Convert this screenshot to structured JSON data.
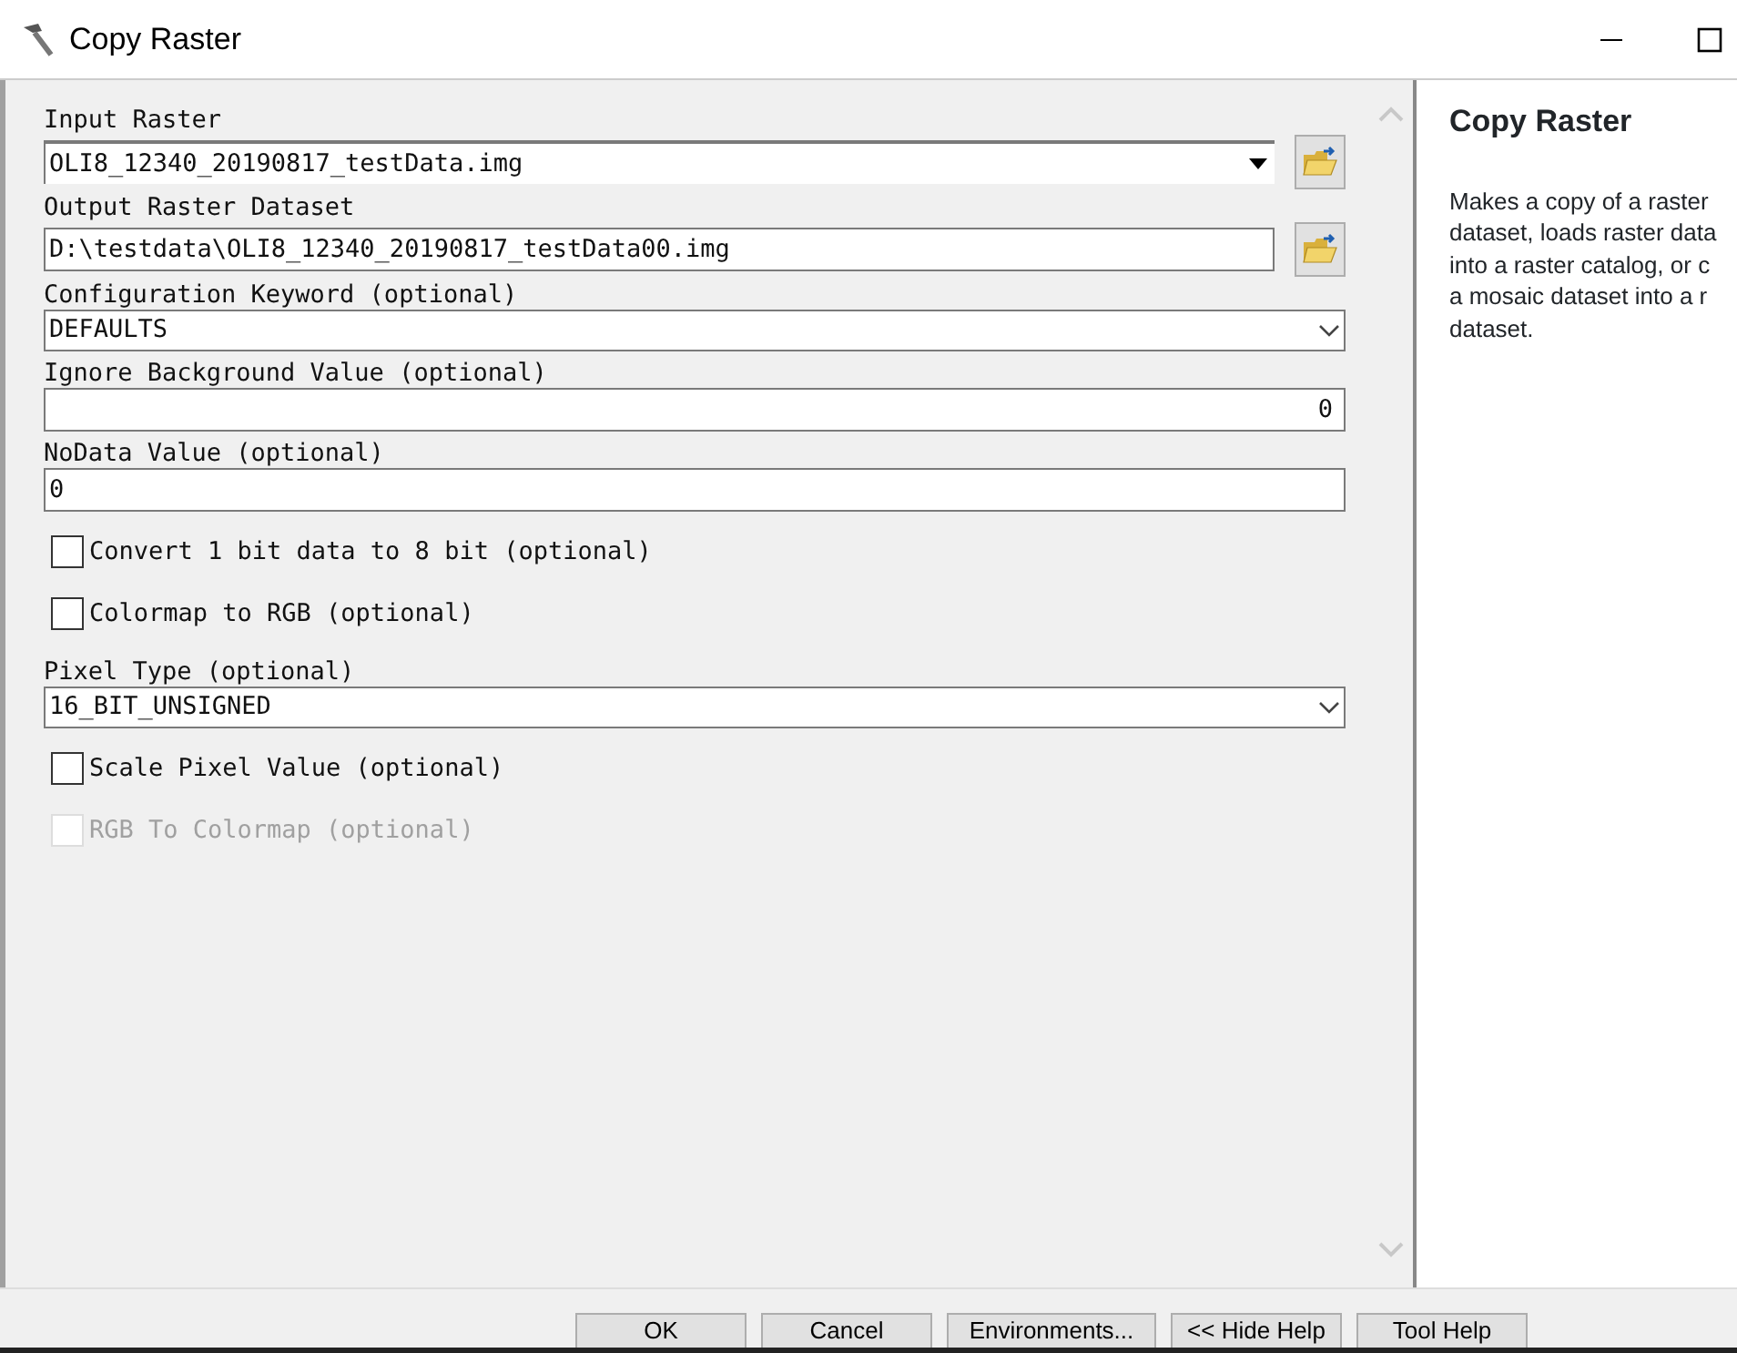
{
  "window": {
    "title": "Copy Raster"
  },
  "parameters": [
    {
      "kind": "combo",
      "label": "Input Raster",
      "value": "OLI8_12340_20190817_testData.img",
      "browse": true
    },
    {
      "kind": "text",
      "label": "Output Raster Dataset",
      "value": "D:\\testdata\\OLI8_12340_20190817_testData00.img",
      "browse": true
    },
    {
      "kind": "dropdown",
      "label": "Configuration Keyword (optional)",
      "value": "DEFAULTS"
    },
    {
      "kind": "number",
      "label": "Ignore Background Value (optional)",
      "value": "0"
    },
    {
      "kind": "text",
      "label": "NoData Value (optional)",
      "value": "0",
      "browse": false
    },
    {
      "kind": "checkbox",
      "label": "Convert 1 bit data to 8 bit (optional)",
      "checked": false,
      "disabled": false
    },
    {
      "kind": "checkbox",
      "label": "Colormap to RGB (optional)",
      "checked": false,
      "disabled": false
    },
    {
      "kind": "dropdown",
      "label": "Pixel Type (optional)",
      "value": "16_BIT_UNSIGNED"
    },
    {
      "kind": "checkbox",
      "label": "Scale Pixel Value (optional)",
      "checked": false,
      "disabled": false
    },
    {
      "kind": "checkbox",
      "label": "RGB To Colormap (optional)",
      "checked": false,
      "disabled": true
    }
  ],
  "help": {
    "title": "Copy Raster",
    "lines": [
      "Makes a copy of a raster",
      "dataset, loads raster data",
      "into a raster catalog, or c",
      "a mosaic dataset into a r",
      "dataset."
    ]
  },
  "buttons": [
    "OK",
    "Cancel",
    "Environments...",
    "<< Hide Help",
    "Tool Help"
  ]
}
